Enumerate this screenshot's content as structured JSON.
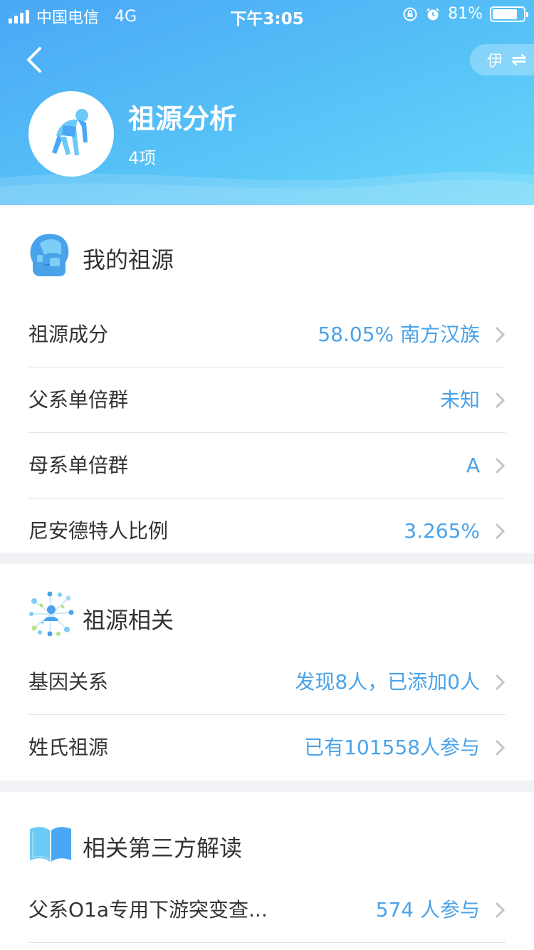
{
  "status_bar": {
    "carrier": "中国电信",
    "network": "4G",
    "time": "下午3:05",
    "battery": "81%",
    "battery_level": 0.81
  },
  "header": {
    "title": "祖源分析",
    "subtitle": "4项",
    "lang_label": "伊",
    "swap_icon": "⇌",
    "avatar_icon": "ape-icon"
  },
  "sections": {
    "my_ancestry": {
      "title": "我的祖源",
      "icon": "face-profile-icon",
      "rows": [
        {
          "label": "祖源成分",
          "value": "58.05% 南方汉族"
        },
        {
          "label": "父系单倍群",
          "value": "未知"
        },
        {
          "label": "母系单倍群",
          "value": "A"
        },
        {
          "label": "尼安德特人比例",
          "value": "3.265%"
        }
      ]
    },
    "related": {
      "title": "祖源相关",
      "icon": "network-icon",
      "rows": [
        {
          "label": "基因关系",
          "value": "发现8人，已添加0人"
        },
        {
          "label": "姓氏祖源",
          "value": "已有101558人参与"
        }
      ]
    },
    "third_party": {
      "title": "相关第三方解读",
      "icon": "book-icon",
      "rows": [
        {
          "label": "父系O1a专用下游突变查...",
          "value": "574 人参与"
        }
      ]
    }
  },
  "colors": {
    "accent": "#4aa3ea",
    "header_start": "#4aa7f5",
    "header_end": "#6ad7fb",
    "text": "#333333"
  }
}
